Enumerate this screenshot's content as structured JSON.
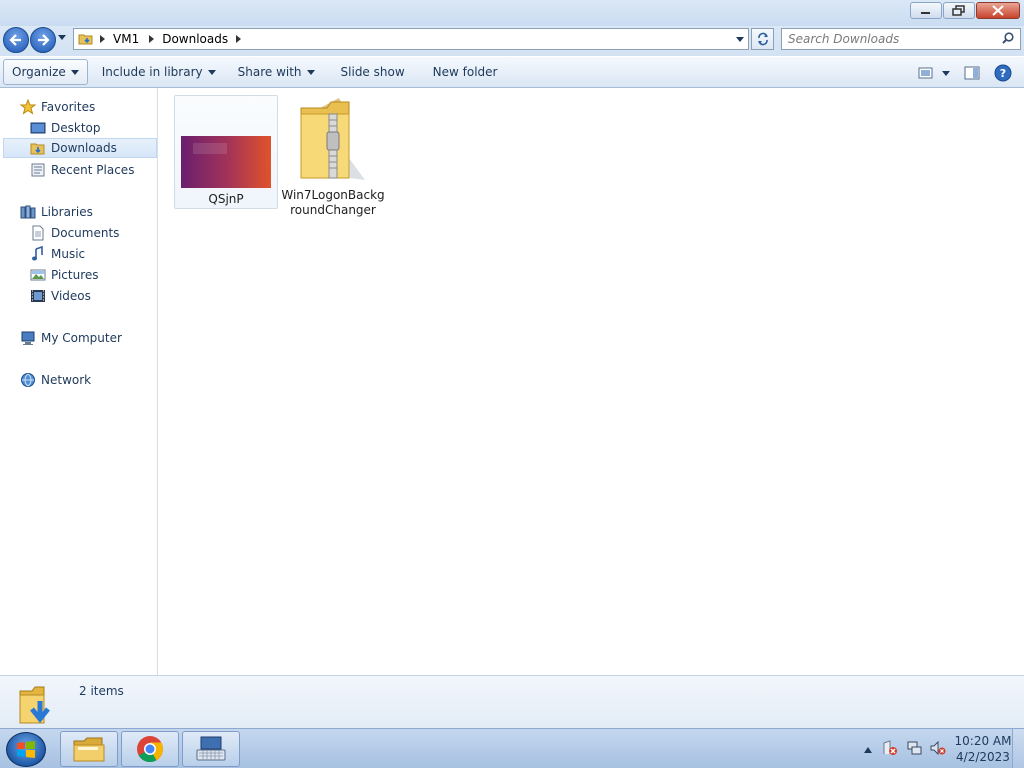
{
  "window": {
    "controls": {
      "minimize": "minimize",
      "maximize": "restore",
      "close": "close"
    }
  },
  "address": {
    "breadcrumbs": [
      "VM1",
      "Downloads"
    ],
    "search_placeholder": "Search Downloads"
  },
  "toolbar": {
    "organize": "Organize",
    "include_in_library": "Include in library",
    "share_with": "Share with",
    "slide_show": "Slide show",
    "new_folder": "New folder"
  },
  "nav": {
    "favorites": {
      "label": "Favorites",
      "items": [
        "Desktop",
        "Downloads",
        "Recent Places"
      ]
    },
    "libraries": {
      "label": "Libraries",
      "items": [
        "Documents",
        "Music",
        "Pictures",
        "Videos"
      ]
    },
    "computer": "My Computer",
    "network": "Network",
    "selected": "Downloads"
  },
  "files": [
    {
      "name": "QSjnP",
      "type": "image",
      "selected": true
    },
    {
      "name": "Win7LogonBackgroundChanger",
      "name_lines": [
        "Win7LogonBackg",
        "roundChanger"
      ],
      "type": "zip-folder",
      "selected": false
    }
  ],
  "details": {
    "count": "2 items"
  },
  "taskbar": {
    "pinned": [
      "windows-explorer",
      "chrome",
      "keyboard-app"
    ],
    "clock": {
      "time": "10:20 AM",
      "date": "4/2/2023"
    }
  },
  "colors": {
    "accent": "#1e395b",
    "selection": "#d6e6f8",
    "thumbnail_start": "#6a1f6e",
    "thumbnail_end": "#e0522a"
  }
}
